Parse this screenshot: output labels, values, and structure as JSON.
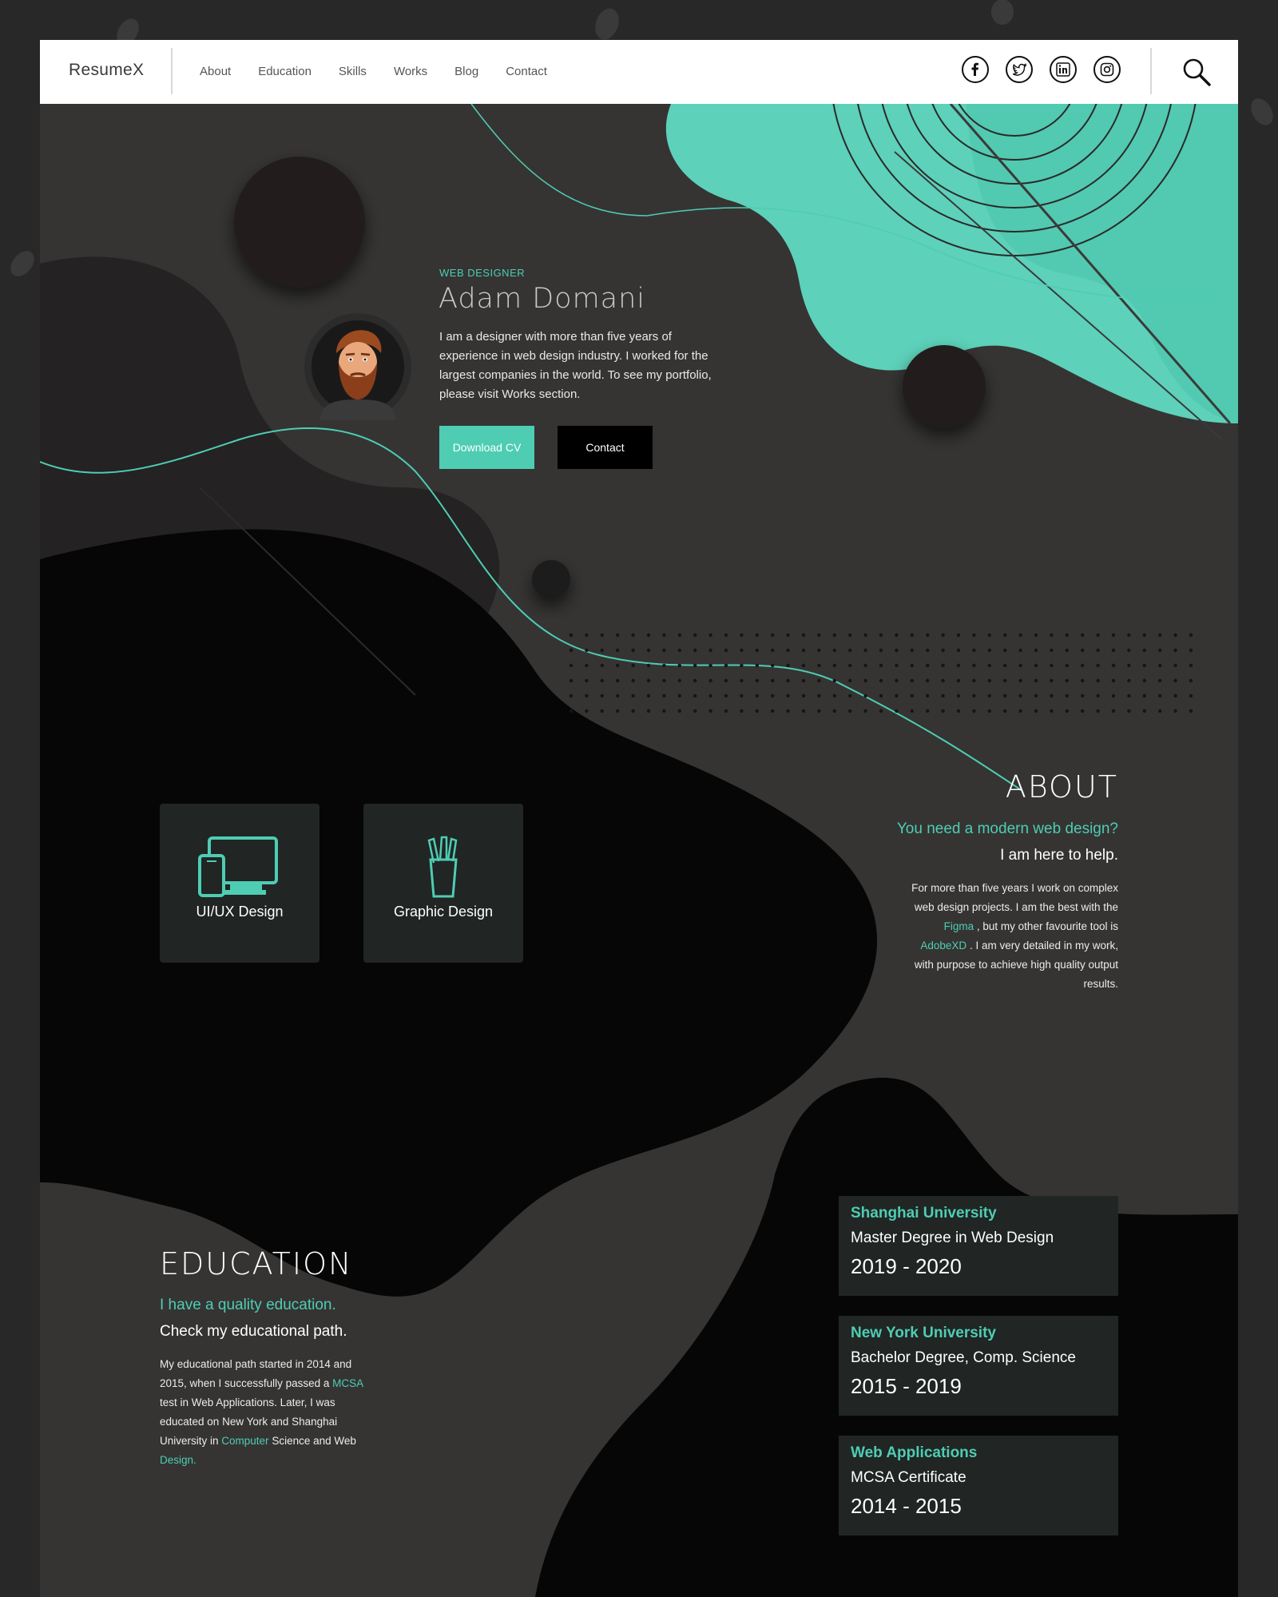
{
  "colors": {
    "accent": "#4ecdb3",
    "dark": "#353433",
    "card": "#212524"
  },
  "header": {
    "logo": "ResumeX",
    "nav": [
      "About",
      "Education",
      "Skills",
      "Works",
      "Blog",
      "Contact"
    ],
    "social_icons": [
      "facebook-icon",
      "twitter-icon",
      "linkedin-icon",
      "instagram-icon"
    ],
    "search_icon": "search-icon"
  },
  "hero": {
    "role": "WEB DESIGNER",
    "name": "Adam Domani",
    "bio": "I am a designer with more than five years of experience in web design industry. I worked for the largest companies in the world. To see my portfolio, please visit Works section.",
    "download_label": "Download CV",
    "contact_label": "Contact"
  },
  "about": {
    "title": "ABOUT",
    "subtitle1": "You need a modern web design?",
    "subtitle2": "I am here to help.",
    "text_part1": "For more than five years I work on complex web design projects. I am the best with the ",
    "tool1": "Figma",
    "text_part2": " , but my other favourite tool is ",
    "tool2": "AdobeXD",
    "text_part3": " . I am very detailed in my work, with purpose to achieve high quality output results.",
    "cards": [
      {
        "label": "UI/UX Design",
        "icon": "devices-icon"
      },
      {
        "label": "Graphic Design",
        "icon": "pencil-cup-icon"
      }
    ]
  },
  "education": {
    "title": "EDUCATION",
    "subtitle1": "I have a quality education.",
    "subtitle2": "Check my educational path.",
    "text_part1": "My educational path started in 2014 and 2015, when I successfully passed a ",
    "link1": "MCSA",
    "text_part2": " test in Web Applications. Later, I was educated on New York and Shanghai University in ",
    "link2": "Computer",
    "text_part3": " Science and Web ",
    "link3": "Design.",
    "items": [
      {
        "institution": "Shanghai University",
        "degree": "Master Degree in Web Design",
        "years": "2019  -  2020"
      },
      {
        "institution": "New York University",
        "degree": "Bachelor Degree, Comp. Science",
        "years": "2015  -  2019"
      },
      {
        "institution": "Web Applications",
        "degree": "MCSA Certificate",
        "years": "2014  -  2015"
      }
    ]
  }
}
